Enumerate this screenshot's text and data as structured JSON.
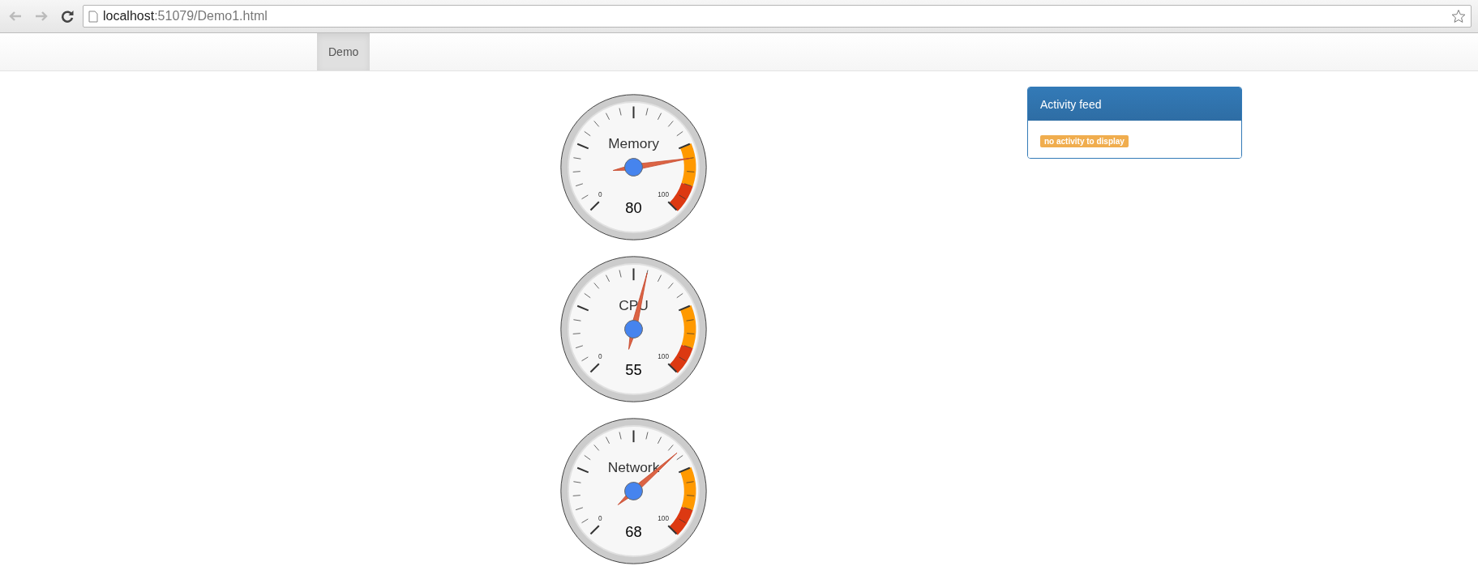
{
  "browser": {
    "url_host": "localhost",
    "url_path": ":51079/Demo1.html",
    "bookmarked": false
  },
  "navbar": {
    "tabs": [
      {
        "label": "Demo",
        "selected": true
      }
    ]
  },
  "gauges": [
    {
      "label": "Memory",
      "value": "80",
      "min_label": "0",
      "max_label": "100"
    },
    {
      "label": "CPU",
      "value": "55",
      "min_label": "0",
      "max_label": "100"
    },
    {
      "label": "Network",
      "value": "68",
      "min_label": "0",
      "max_label": "100"
    }
  ],
  "activity_feed": {
    "title": "Activity feed",
    "empty_badge": "no activity to display"
  }
}
